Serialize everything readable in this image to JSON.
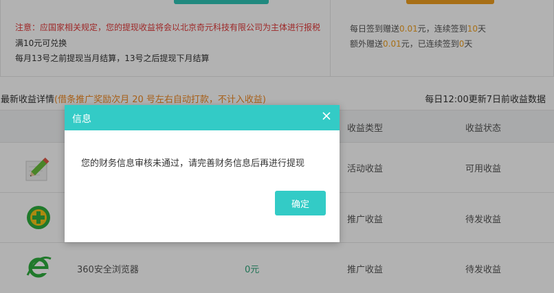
{
  "earnings_notice": {
    "warning": "注意：应国家相关规定，您的提现收益将会以北京奇元科技有限公司为主体进行报税",
    "min_exchange": "满10元可兑换",
    "settlement": "每月13号之前提现当月结算，13号之后提现下月结算"
  },
  "sign_in": {
    "line1_prefix": "每日签到赠送",
    "line1_amount": "0.01",
    "line1_mid": "元，连续签到",
    "line1_days": "10",
    "line1_suffix": "天",
    "line2_prefix": "额外赠送",
    "line2_amount": "0.01",
    "line2_mid": "元，已连续签到",
    "line2_days": "0",
    "line2_suffix": "天"
  },
  "details": {
    "title": "最新收益详情",
    "note": "(借条推广奖励次月 20 号左右自动打款，不计入收益)",
    "update_info": "每日12:00更新7日前收益数据"
  },
  "table": {
    "columns": [
      "收益类型",
      "收益状态"
    ],
    "rows": [
      {
        "icon": "pencil-notepad-icon",
        "name": "",
        "amount": "",
        "type": "活动收益",
        "status": "可用收益"
      },
      {
        "icon": "360-plus-icon",
        "name": "",
        "amount": "",
        "type": "推广收益",
        "status": "待发收益"
      },
      {
        "icon": "360-browser-icon",
        "name": "360安全浏览器",
        "amount": "0元",
        "type": "推广收益",
        "status": "待发收益"
      }
    ]
  },
  "dialog": {
    "title": "信息",
    "message": "您的财务信息审核未通过，请完善财务信息后再进行提现",
    "ok_label": "确定",
    "close_icon": "close-icon"
  },
  "colors": {
    "accent": "#33cbc6",
    "warning_text": "#e23a3a",
    "highlight": "#f0a020",
    "note": "#f08a24",
    "amount": "#2ea57a"
  }
}
